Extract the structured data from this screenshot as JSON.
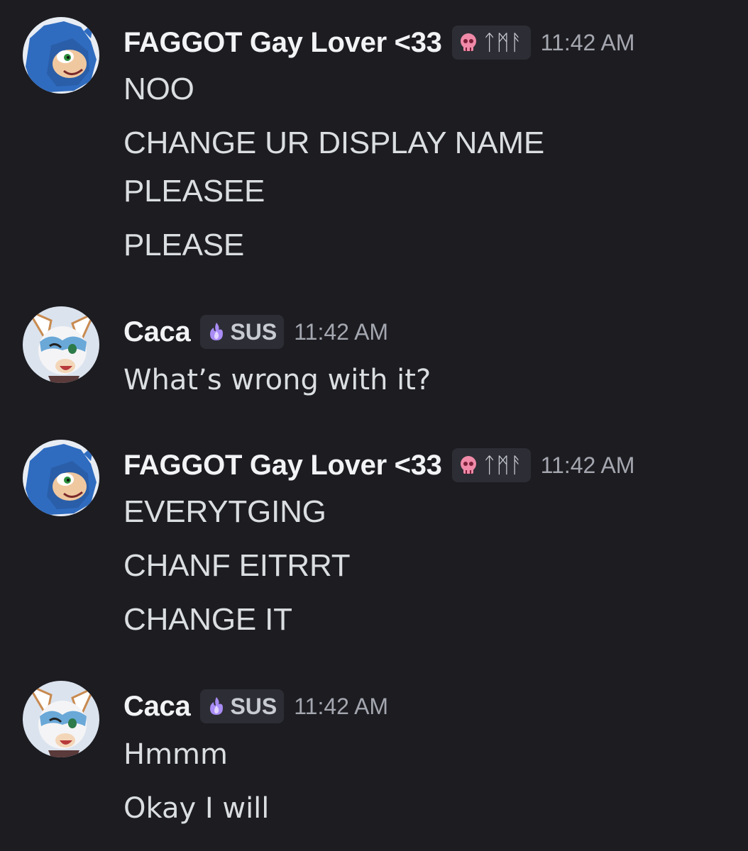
{
  "messages": [
    {
      "author": "FAGGOT Gay Lover <33",
      "avatar_icon": "hedgehog-avatar-icon",
      "tag_icon": "pink-skull-icon",
      "tag_text": "ᛏᛗᚨ",
      "timestamp": "11:42 AM",
      "lines": [
        "NOO",
        "CHANGE UR DISPLAY NAME",
        "PLEASEE",
        "PLEASE"
      ]
    },
    {
      "author": "Caca",
      "avatar_icon": "bat-girl-avatar-icon",
      "tag_icon": "purple-flame-icon",
      "tag_text": "SUS",
      "timestamp": "11:42 AM",
      "lines": [
        "What’s wrong with it?"
      ]
    },
    {
      "author": "FAGGOT Gay Lover <33",
      "avatar_icon": "hedgehog-avatar-icon",
      "tag_icon": "pink-skull-icon",
      "tag_text": "ᛏᛗᚨ",
      "timestamp": "11:42 AM",
      "lines": [
        "EVERYTGING",
        "CHANF EITRRT",
        "CHANGE IT"
      ]
    },
    {
      "author": "Caca",
      "avatar_icon": "bat-girl-avatar-icon",
      "tag_icon": "purple-flame-icon",
      "tag_text": "SUS",
      "timestamp": "11:42 AM",
      "lines": [
        "Hmmm",
        "Okay I will"
      ]
    }
  ],
  "colors": {
    "background": "#1c1c21",
    "username": "#f2f3f5",
    "message_text": "#dbdee1",
    "timestamp": "#a5a7b0",
    "tag_background": "#2d2e35",
    "skull": "#f08aa8",
    "flame": "#a98cf5"
  }
}
